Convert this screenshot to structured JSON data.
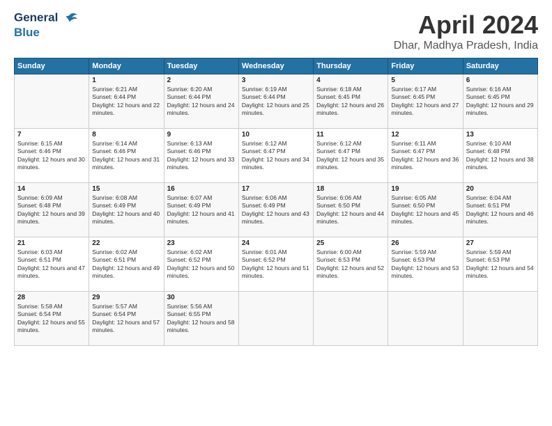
{
  "header": {
    "logo_line1": "General",
    "logo_line2": "Blue",
    "month": "April 2024",
    "location": "Dhar, Madhya Pradesh, India"
  },
  "weekdays": [
    "Sunday",
    "Monday",
    "Tuesday",
    "Wednesday",
    "Thursday",
    "Friday",
    "Saturday"
  ],
  "weeks": [
    [
      {
        "day": "",
        "sunrise": "",
        "sunset": "",
        "daylight": ""
      },
      {
        "day": "1",
        "sunrise": "Sunrise: 6:21 AM",
        "sunset": "Sunset: 6:44 PM",
        "daylight": "Daylight: 12 hours and 22 minutes."
      },
      {
        "day": "2",
        "sunrise": "Sunrise: 6:20 AM",
        "sunset": "Sunset: 6:44 PM",
        "daylight": "Daylight: 12 hours and 24 minutes."
      },
      {
        "day": "3",
        "sunrise": "Sunrise: 6:19 AM",
        "sunset": "Sunset: 6:44 PM",
        "daylight": "Daylight: 12 hours and 25 minutes."
      },
      {
        "day": "4",
        "sunrise": "Sunrise: 6:18 AM",
        "sunset": "Sunset: 6:45 PM",
        "daylight": "Daylight: 12 hours and 26 minutes."
      },
      {
        "day": "5",
        "sunrise": "Sunrise: 6:17 AM",
        "sunset": "Sunset: 6:45 PM",
        "daylight": "Daylight: 12 hours and 27 minutes."
      },
      {
        "day": "6",
        "sunrise": "Sunrise: 6:16 AM",
        "sunset": "Sunset: 6:45 PM",
        "daylight": "Daylight: 12 hours and 29 minutes."
      }
    ],
    [
      {
        "day": "7",
        "sunrise": "Sunrise: 6:15 AM",
        "sunset": "Sunset: 6:46 PM",
        "daylight": "Daylight: 12 hours and 30 minutes."
      },
      {
        "day": "8",
        "sunrise": "Sunrise: 6:14 AM",
        "sunset": "Sunset: 6:46 PM",
        "daylight": "Daylight: 12 hours and 31 minutes."
      },
      {
        "day": "9",
        "sunrise": "Sunrise: 6:13 AM",
        "sunset": "Sunset: 6:46 PM",
        "daylight": "Daylight: 12 hours and 33 minutes."
      },
      {
        "day": "10",
        "sunrise": "Sunrise: 6:12 AM",
        "sunset": "Sunset: 6:47 PM",
        "daylight": "Daylight: 12 hours and 34 minutes."
      },
      {
        "day": "11",
        "sunrise": "Sunrise: 6:12 AM",
        "sunset": "Sunset: 6:47 PM",
        "daylight": "Daylight: 12 hours and 35 minutes."
      },
      {
        "day": "12",
        "sunrise": "Sunrise: 6:11 AM",
        "sunset": "Sunset: 6:47 PM",
        "daylight": "Daylight: 12 hours and 36 minutes."
      },
      {
        "day": "13",
        "sunrise": "Sunrise: 6:10 AM",
        "sunset": "Sunset: 6:48 PM",
        "daylight": "Daylight: 12 hours and 38 minutes."
      }
    ],
    [
      {
        "day": "14",
        "sunrise": "Sunrise: 6:09 AM",
        "sunset": "Sunset: 6:48 PM",
        "daylight": "Daylight: 12 hours and 39 minutes."
      },
      {
        "day": "15",
        "sunrise": "Sunrise: 6:08 AM",
        "sunset": "Sunset: 6:49 PM",
        "daylight": "Daylight: 12 hours and 40 minutes."
      },
      {
        "day": "16",
        "sunrise": "Sunrise: 6:07 AM",
        "sunset": "Sunset: 6:49 PM",
        "daylight": "Daylight: 12 hours and 41 minutes."
      },
      {
        "day": "17",
        "sunrise": "Sunrise: 6:06 AM",
        "sunset": "Sunset: 6:49 PM",
        "daylight": "Daylight: 12 hours and 43 minutes."
      },
      {
        "day": "18",
        "sunrise": "Sunrise: 6:06 AM",
        "sunset": "Sunset: 6:50 PM",
        "daylight": "Daylight: 12 hours and 44 minutes."
      },
      {
        "day": "19",
        "sunrise": "Sunrise: 6:05 AM",
        "sunset": "Sunset: 6:50 PM",
        "daylight": "Daylight: 12 hours and 45 minutes."
      },
      {
        "day": "20",
        "sunrise": "Sunrise: 6:04 AM",
        "sunset": "Sunset: 6:51 PM",
        "daylight": "Daylight: 12 hours and 46 minutes."
      }
    ],
    [
      {
        "day": "21",
        "sunrise": "Sunrise: 6:03 AM",
        "sunset": "Sunset: 6:51 PM",
        "daylight": "Daylight: 12 hours and 47 minutes."
      },
      {
        "day": "22",
        "sunrise": "Sunrise: 6:02 AM",
        "sunset": "Sunset: 6:51 PM",
        "daylight": "Daylight: 12 hours and 49 minutes."
      },
      {
        "day": "23",
        "sunrise": "Sunrise: 6:02 AM",
        "sunset": "Sunset: 6:52 PM",
        "daylight": "Daylight: 12 hours and 50 minutes."
      },
      {
        "day": "24",
        "sunrise": "Sunrise: 6:01 AM",
        "sunset": "Sunset: 6:52 PM",
        "daylight": "Daylight: 12 hours and 51 minutes."
      },
      {
        "day": "25",
        "sunrise": "Sunrise: 6:00 AM",
        "sunset": "Sunset: 6:53 PM",
        "daylight": "Daylight: 12 hours and 52 minutes."
      },
      {
        "day": "26",
        "sunrise": "Sunrise: 5:59 AM",
        "sunset": "Sunset: 6:53 PM",
        "daylight": "Daylight: 12 hours and 53 minutes."
      },
      {
        "day": "27",
        "sunrise": "Sunrise: 5:59 AM",
        "sunset": "Sunset: 6:53 PM",
        "daylight": "Daylight: 12 hours and 54 minutes."
      }
    ],
    [
      {
        "day": "28",
        "sunrise": "Sunrise: 5:58 AM",
        "sunset": "Sunset: 6:54 PM",
        "daylight": "Daylight: 12 hours and 55 minutes."
      },
      {
        "day": "29",
        "sunrise": "Sunrise: 5:57 AM",
        "sunset": "Sunset: 6:54 PM",
        "daylight": "Daylight: 12 hours and 57 minutes."
      },
      {
        "day": "30",
        "sunrise": "Sunrise: 5:56 AM",
        "sunset": "Sunset: 6:55 PM",
        "daylight": "Daylight: 12 hours and 58 minutes."
      },
      {
        "day": "",
        "sunrise": "",
        "sunset": "",
        "daylight": ""
      },
      {
        "day": "",
        "sunrise": "",
        "sunset": "",
        "daylight": ""
      },
      {
        "day": "",
        "sunrise": "",
        "sunset": "",
        "daylight": ""
      },
      {
        "day": "",
        "sunrise": "",
        "sunset": "",
        "daylight": ""
      }
    ]
  ]
}
